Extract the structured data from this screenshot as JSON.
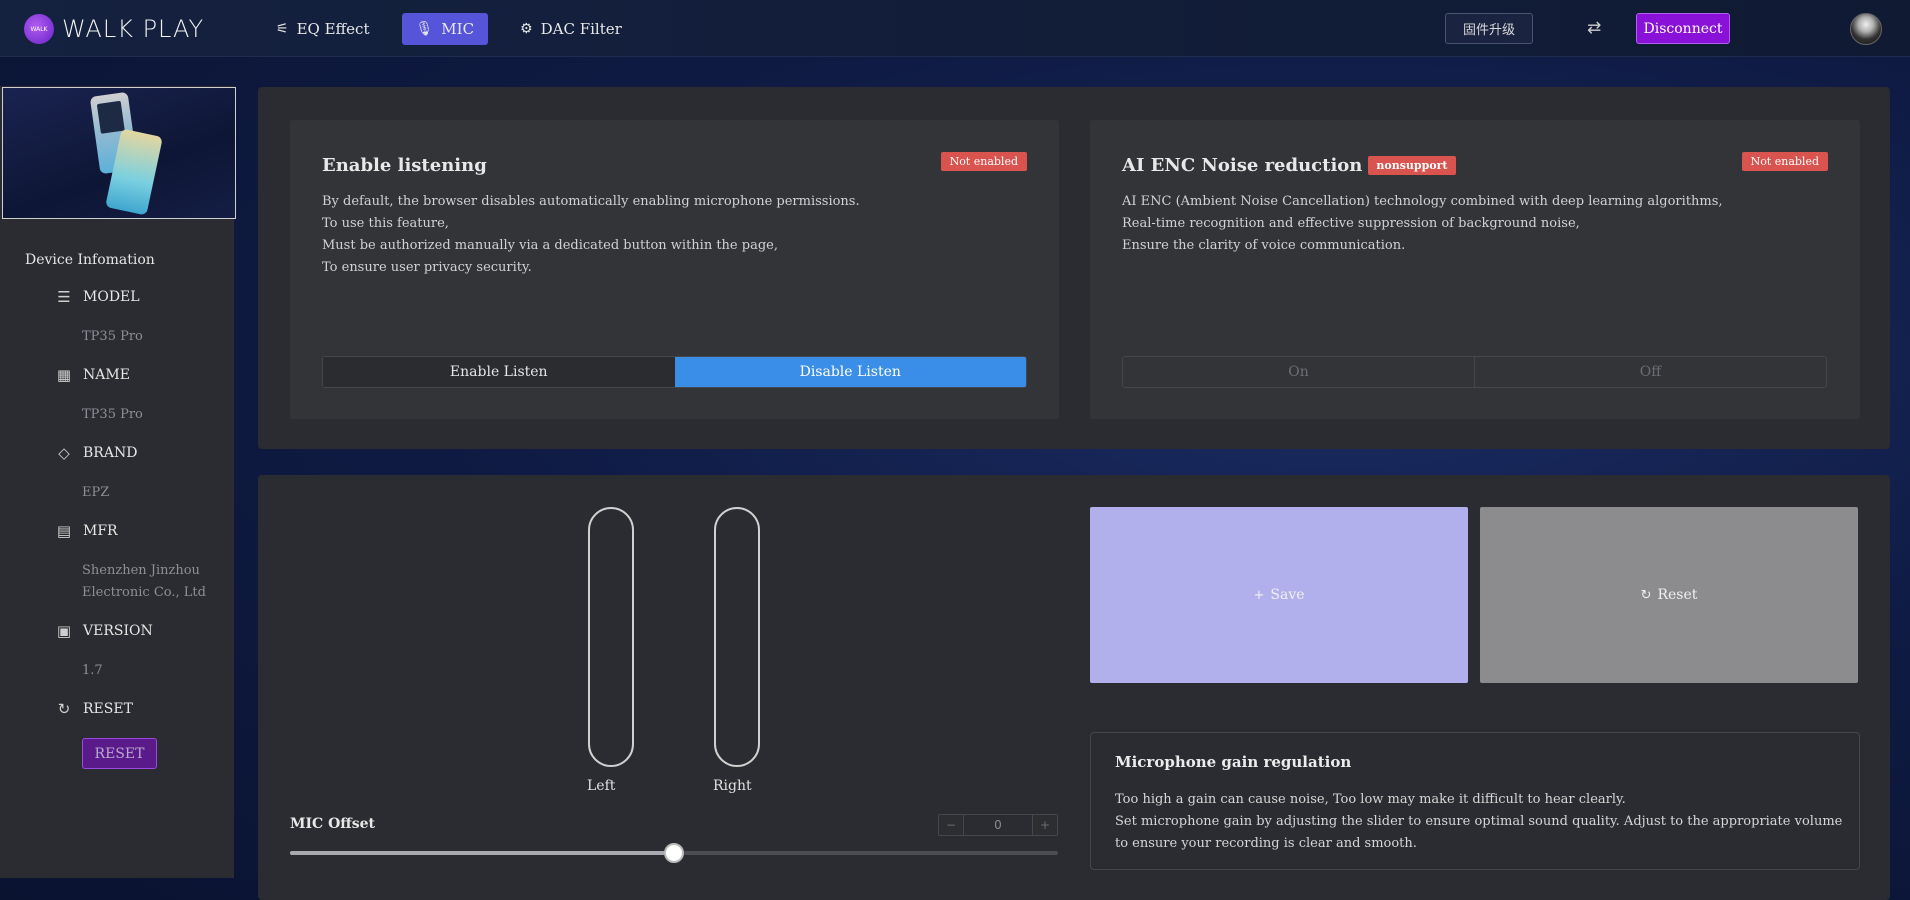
{
  "header": {
    "logo_mark": "WALK",
    "logo_text": "WALK PLAY",
    "nav": [
      {
        "label": "EQ Effect",
        "icon": "sliders-icon"
      },
      {
        "label": "MIC",
        "icon": "microphone-icon"
      },
      {
        "label": "DAC Filter",
        "icon": "gear-icon"
      }
    ],
    "firmware_button": "固件升级",
    "translate_icon": "translate-icon",
    "disconnect_button": "Disconnect"
  },
  "sidebar": {
    "title": "Device Infomation",
    "items": [
      {
        "label": "MODEL",
        "value": "TP35 Pro",
        "icon": "server-icon"
      },
      {
        "label": "NAME",
        "value": "TP35 Pro",
        "icon": "building-icon"
      },
      {
        "label": "BRAND",
        "value": "EPZ",
        "icon": "tag-icon"
      },
      {
        "label": "MFR",
        "value": "Shenzhen Jinzhou Electronic Co., Ltd",
        "icon": "document-icon"
      },
      {
        "label": "VERSION",
        "value": "1.7",
        "icon": "chip-icon"
      },
      {
        "label": "RESET",
        "icon": "refresh-icon"
      }
    ],
    "reset_button": "RESET"
  },
  "listening": {
    "title": "Enable listening",
    "status": "Not enabled",
    "desc": [
      "By default, the browser disables automatically enabling microphone permissions.",
      "To use this feature,",
      "Must be authorized manually via a dedicated button within the page,",
      "To ensure user privacy security."
    ],
    "enable_label": "Enable Listen",
    "disable_label": "Disable Listen"
  },
  "enc": {
    "title": "AI ENC Noise reduction",
    "support_badge": "nonsupport",
    "status": "Not enabled",
    "desc": [
      "AI ENC (Ambient Noise Cancellation) technology combined with deep learning algorithms,",
      "Real-time recognition and effective suppression of background noise,",
      "Ensure the clarity of voice communication."
    ],
    "on_label": "On",
    "off_label": "Off"
  },
  "mic": {
    "left_label": "Left",
    "right_label": "Right",
    "offset_label": "MIC Offset",
    "offset_value": "0",
    "offset_slider_fraction": 0.5,
    "minus": "−",
    "plus": "+"
  },
  "actions": {
    "save_label": "Save",
    "reset_label": "Reset"
  },
  "gain": {
    "title": "Microphone gain regulation",
    "desc1": "Too high a gain can cause noise, Too low may make it difficult to hear clearly.",
    "desc2": "Set microphone gain by adjusting the slider to ensure optimal sound quality. Adjust to the appropriate volume to ensure your recording is clear and smooth."
  }
}
